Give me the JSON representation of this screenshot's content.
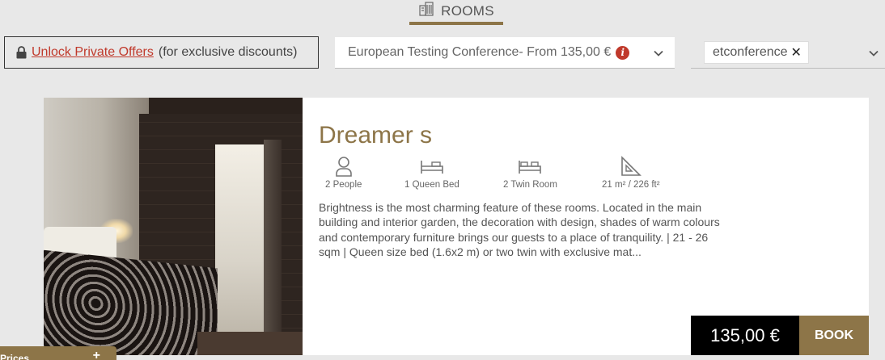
{
  "tab": {
    "label": "ROOMS",
    "icon": "building-icon"
  },
  "unlock": {
    "link_text": "Unlock Private Offers",
    "suffix": "(for exclusive discounts)"
  },
  "rate_select": {
    "value": "European Testing Conference- From  135,00 €",
    "info_glyph": "i"
  },
  "promo": {
    "code": "etconference",
    "remove_glyph": "✕"
  },
  "room": {
    "name": "Dreamer s",
    "amenities": [
      {
        "icon": "person-icon",
        "label": "2 People"
      },
      {
        "icon": "queen-bed-icon",
        "label": "1 Queen Bed"
      },
      {
        "icon": "twin-bed-icon",
        "label": "2 Twin Room"
      },
      {
        "icon": "area-icon",
        "label": "21 m² / 226 ft²"
      }
    ],
    "description": "Brightness is the most charming feature of these rooms. Located in the main building and interior garden, the decoration with design, shades of warm colours and contemporary furniture brings our guests to a place of tranquility. | 21 - 26 sqm | Queen size bed (1.6x2 m) or two twin with exclusive mat...",
    "price": "135,00 €",
    "book_label": "BOOK"
  },
  "prices_tab": {
    "label": "Prices",
    "toggle": "+"
  },
  "colors": {
    "accent": "#8d7548",
    "link": "#c0392b",
    "background": "#e8e8e8"
  }
}
